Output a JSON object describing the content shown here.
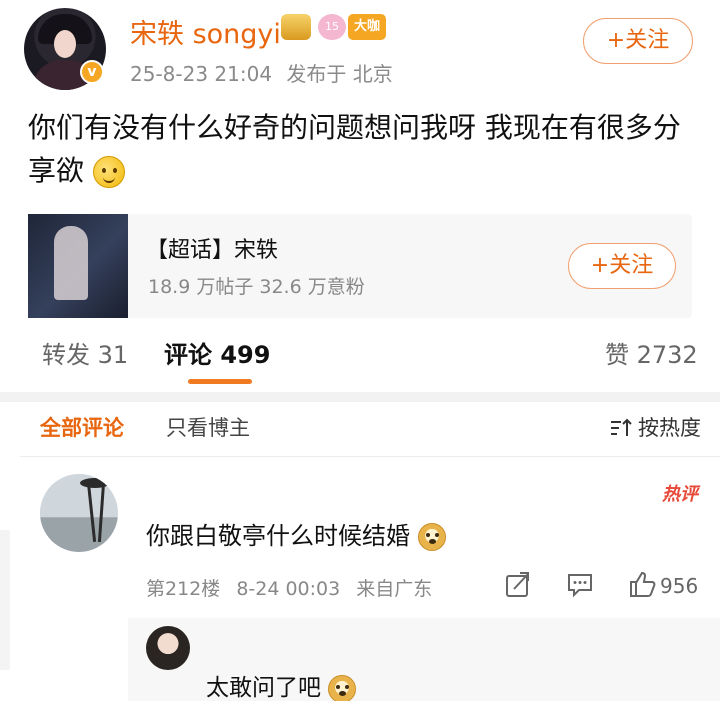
{
  "post": {
    "username": "宋轶 songyi",
    "badges": [
      "crown-badge",
      "level-badge",
      "big-v-badge"
    ],
    "level_badge_text": "15",
    "big_badge_text": "大咖",
    "timestamp": "25-8-23 21:04",
    "location": "发布于 北京",
    "follow_label": "+关注",
    "text": "你们有没有什么好奇的问题想问我呀 我现在有很多分享欲"
  },
  "topic": {
    "title": "【超话】宋轶",
    "stats": "18.9 万帖子  32.6 万意粉",
    "follow_label": "+关注"
  },
  "tabs": {
    "repost": "转发 31",
    "comment": "评论 499",
    "like": "赞 2732"
  },
  "filter": {
    "all": "全部评论",
    "host_only": "只看博主",
    "sort": "按热度"
  },
  "comment": {
    "username": "　　　　",
    "hot_tag": "热评",
    "text": "你跟白敬亭什么时候结婚",
    "floor": "第212楼",
    "time": "8-24 00:03",
    "source": "来自广东",
    "likes": "956"
  },
  "reply": {
    "username": "　　　　",
    "text": "太敢问了吧"
  },
  "colors": {
    "accent": "#e8660f",
    "hot": "#e84a3a"
  }
}
